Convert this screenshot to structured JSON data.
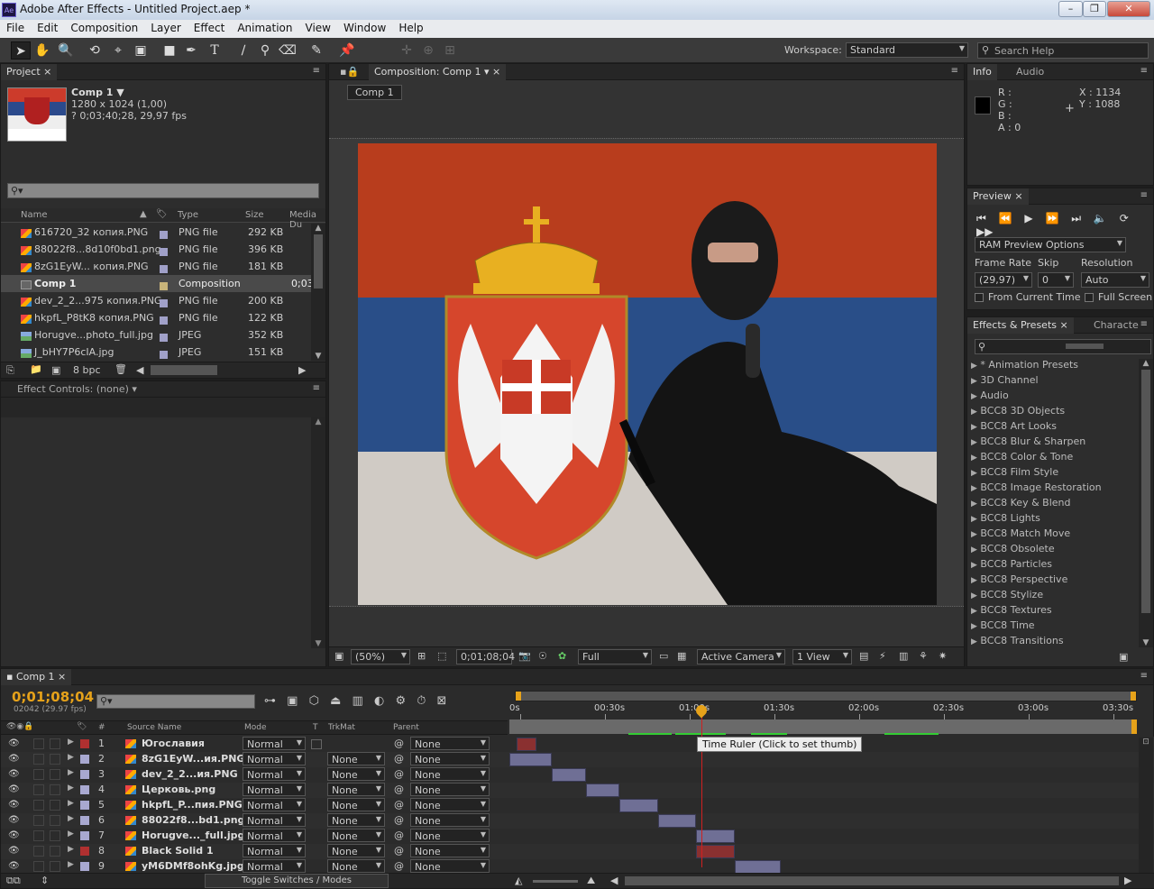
{
  "window": {
    "title": "Adobe After Effects - Untitled Project.aep *",
    "icon": "Ae"
  },
  "menu": [
    "File",
    "Edit",
    "Composition",
    "Layer",
    "Effect",
    "Animation",
    "View",
    "Window",
    "Help"
  ],
  "toolbar": {
    "workspace_label": "Workspace:",
    "workspace_value": "Standard",
    "search_placeholder": "Search Help"
  },
  "project": {
    "tab": "Project",
    "comp_name": "Comp 1 ▼",
    "comp_size": "1280 x 1024 (1,00)",
    "comp_dur": "? 0;03;40;28, 29,97 fps",
    "columns": [
      "Name",
      "Type",
      "Size",
      "Media Du"
    ],
    "items": [
      {
        "name": "616720_32 копия.PNG",
        "type": "PNG file",
        "size": "292 KB",
        "dur": ""
      },
      {
        "name": "88022f8...8d10f0bd1.png",
        "type": "PNG file",
        "size": "396 KB",
        "dur": ""
      },
      {
        "name": "8zG1EyW... копия.PNG",
        "type": "PNG file",
        "size": "181 KB",
        "dur": ""
      },
      {
        "name": "Comp 1",
        "type": "Composition",
        "size": "",
        "dur": "0;03"
      },
      {
        "name": "dev_2_2...975 копия.PNG",
        "type": "PNG file",
        "size": "200 KB",
        "dur": ""
      },
      {
        "name": "hkpfL_P8tK8 копия.PNG",
        "type": "PNG file",
        "size": "122 KB",
        "dur": ""
      },
      {
        "name": "Horugve...photo_full.jpg",
        "type": "JPEG",
        "size": "352 KB",
        "dur": ""
      },
      {
        "name": "J_bHY7P6cIA.jpg",
        "type": "JPEG",
        "size": "151 KB",
        "dur": ""
      }
    ],
    "bpc": "8 bpc"
  },
  "effect_controls": {
    "tab": "Effect Controls: (none)"
  },
  "composition": {
    "tab": "Composition: Comp 1",
    "breadcrumb": "Comp 1",
    "zoom": "(50%)",
    "timecode": "0;01;08;04",
    "resolution": "Full",
    "camera": "Active Camera",
    "views": "1 View"
  },
  "info": {
    "tab": "Info",
    "tab2": "Audio",
    "r": "R :",
    "g": "G :",
    "b": "B :",
    "a": "A : 0",
    "x": "X : 1134",
    "y": "Y : 1088"
  },
  "preview": {
    "tab": "Preview",
    "ram": "RAM Preview Options",
    "frame_rate_label": "Frame Rate",
    "skip_label": "Skip",
    "resolution_label": "Resolution",
    "frame_rate": "(29,97)",
    "skip": "0",
    "resolution": "Auto",
    "from_current": "From Current Time",
    "full_screen": "Full Screen"
  },
  "effects": {
    "tab": "Effects & Presets",
    "tab2": "Characte",
    "items": [
      "* Animation Presets",
      "3D Channel",
      "Audio",
      "BCC8 3D Objects",
      "BCC8 Art Looks",
      "BCC8 Blur & Sharpen",
      "BCC8 Color & Tone",
      "BCC8 Film Style",
      "BCC8 Image Restoration",
      "BCC8 Key & Blend",
      "BCC8 Lights",
      "BCC8 Match Move",
      "BCC8 Obsolete",
      "BCC8 Particles",
      "BCC8 Perspective",
      "BCC8 Stylize",
      "BCC8 Textures",
      "BCC8 Time",
      "BCC8 Transitions"
    ]
  },
  "timeline": {
    "tab": "Comp 1",
    "timecode": "0;01;08;04",
    "frames": "02042 (29.97 fps)",
    "col_source": "Source Name",
    "col_mode": "Mode",
    "col_t": "T",
    "col_trkmat": "TrkMat",
    "col_parent": "Parent",
    "ticks": [
      "0s",
      "00:30s",
      "01:00s",
      "01:30s",
      "02:00s",
      "02:30s",
      "03:00s",
      "03:30s"
    ],
    "tooltip": "Time Ruler (Click to set thumb)",
    "toggle": "Toggle Switches / Modes",
    "layers": [
      {
        "n": "1",
        "name": "Югославия",
        "mode": "Normal",
        "trk": "",
        "parent": "None",
        "color": "#b03030",
        "start": 0.04,
        "end": 0.16
      },
      {
        "n": "2",
        "name": "8zG1EyW...ия.PNG",
        "mode": "Normal",
        "trk": "None",
        "parent": "None",
        "color": "#a8a8d0",
        "start": 0.0,
        "end": 0.25
      },
      {
        "n": "3",
        "name": "dev_2_2...ия.PNG",
        "mode": "Normal",
        "trk": "None",
        "parent": "None",
        "color": "#a8a8d0",
        "start": 0.25,
        "end": 0.45
      },
      {
        "n": "4",
        "name": "Церковь.png",
        "mode": "Normal",
        "trk": "None",
        "parent": "None",
        "color": "#a8a8d0",
        "start": 0.45,
        "end": 0.65
      },
      {
        "n": "5",
        "name": "hkpfL_P...пия.PNG",
        "mode": "Normal",
        "trk": "None",
        "parent": "None",
        "color": "#a8a8d0",
        "start": 0.65,
        "end": 0.88
      },
      {
        "n": "6",
        "name": "88022f8...bd1.png",
        "mode": "Normal",
        "trk": "None",
        "parent": "None",
        "color": "#a8a8d0",
        "start": 0.88,
        "end": 1.1
      },
      {
        "n": "7",
        "name": "Horugve..._full.jpg",
        "mode": "Normal",
        "trk": "None",
        "parent": "None",
        "color": "#a8a8d0",
        "start": 1.1,
        "end": 1.33
      },
      {
        "n": "8",
        "name": "Black Solid 1",
        "mode": "Normal",
        "trk": "None",
        "parent": "None",
        "color": "#b03030",
        "start": 1.1,
        "end": 1.33
      },
      {
        "n": "9",
        "name": "yM6DMf8ohKg.jpg",
        "mode": "Normal",
        "trk": "None",
        "parent": "None",
        "color": "#a8a8d0",
        "start": 1.33,
        "end": 1.6
      }
    ]
  }
}
